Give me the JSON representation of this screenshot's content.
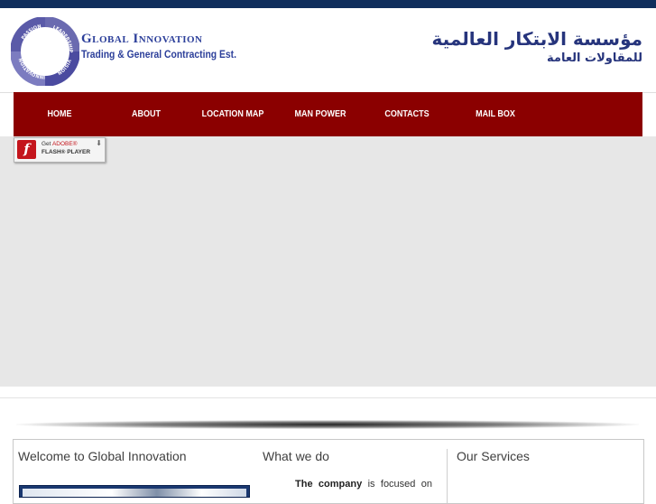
{
  "header": {
    "logo_title": "Global Innovation",
    "logo_subtitle": "Trading & General Contracting Est.",
    "logo_ring_words": [
      "PASSION",
      "LEADERSHIP",
      "VISION",
      "INNOVATION"
    ],
    "arabic_title": "مؤسسة الابتكار العالمية",
    "arabic_subtitle": "للمقاولات العامة"
  },
  "nav": {
    "items": [
      {
        "label": "HOME"
      },
      {
        "label": "ABOUT"
      },
      {
        "label": "LOCATION MAP"
      },
      {
        "label": "MAN POWER"
      },
      {
        "label": "CONTACTS"
      },
      {
        "label": "MAIL BOX"
      }
    ]
  },
  "flash": {
    "line1_prefix": "Get",
    "line1_brand": "ADOBE®",
    "line2": "FLASH® PLAYER",
    "icon_glyph": "f",
    "arrow_glyph": "⬇"
  },
  "sections": {
    "welcome_title": "Welcome to Global Innovation",
    "whatwedo_title": "What we do",
    "services_title": "Our Services",
    "company_bold": "The company",
    "company_rest": " is focused on"
  },
  "colors": {
    "top_bar": "#0f2e5c",
    "nav_background": "#8b0000",
    "logo_blue": "#2c3f9a",
    "stage_gray": "#e7e7e7"
  }
}
